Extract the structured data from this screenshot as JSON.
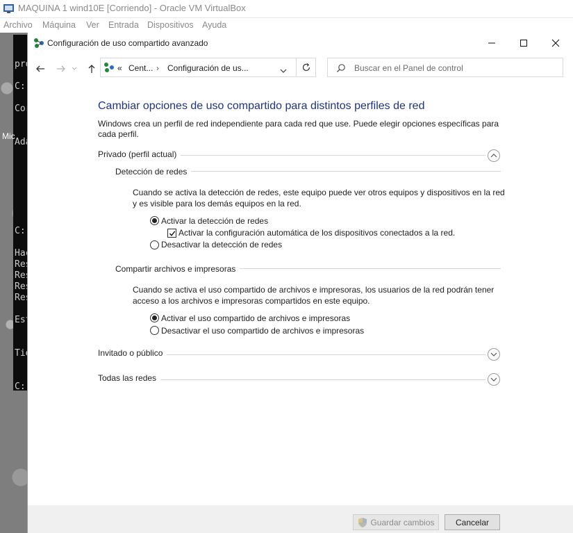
{
  "vbox": {
    "title": "MAQUINA 1 wind10E [Corriendo] - Oracle VM VirtualBox",
    "menu": [
      "Archivo",
      "Máquina",
      "Ver",
      "Entrada",
      "Dispositivos",
      "Ayuda"
    ]
  },
  "guest": {
    "console_lines": [
      "pro",
      "C:",
      "Cor",
      "Ada",
      "C:",
      "Hac",
      "Res",
      "Res",
      "Res",
      "Res",
      "Est",
      "Tie",
      "C:"
    ],
    "desktop_label": "Mic"
  },
  "dialog": {
    "title": "Configuración de uso compartido avanzado",
    "breadcrumb": [
      "Cent...",
      "Configuración de us..."
    ],
    "breadcrumb_prefix": "«",
    "search_placeholder": "Buscar en el Panel de control",
    "heading": "Cambiar opciones de uso compartido para distintos perfiles de red",
    "intro_line1": "Windows crea un perfil de red independiente para cada red que use. Puede elegir opciones específicas para",
    "intro_line2": "cada perfil.",
    "private_section": {
      "title": "Privado (perfil actual)",
      "discovery": {
        "title": "Detección de redes",
        "desc_line1": "Cuando se activa la detección de redes, este equipo puede ver otros equipos y dispositivos en la red",
        "desc_line2": "y es visible para los demás equipos en la red.",
        "option_on": "Activar la detección de redes",
        "auto_config": "Activar la configuración automática de los dispositivos conectados a la red.",
        "option_off": "Desactivar la detección de redes",
        "selected": "on",
        "auto_config_checked": true
      },
      "sharing": {
        "title": "Compartir archivos e impresoras",
        "desc_line1": "Cuando se activa el uso compartido de archivos e impresoras, los usuarios de la red podrán tener",
        "desc_line2": "acceso a los archivos e impresoras compartidos en este equipo.",
        "option_on": "Activar el uso compartido de archivos e impresoras",
        "option_off": "Desactivar el uso compartido de archivos e impresoras",
        "selected": "on"
      }
    },
    "guest_section": {
      "title": "Invitado o público"
    },
    "all_section": {
      "title": "Todas las redes"
    },
    "buttons": {
      "save": "Guardar cambios",
      "cancel": "Cancelar"
    }
  }
}
